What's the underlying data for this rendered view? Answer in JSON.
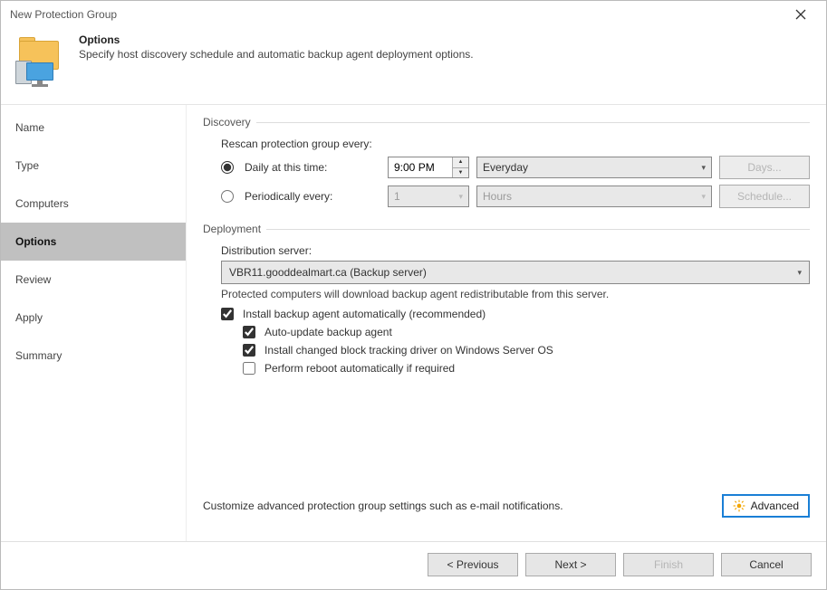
{
  "window": {
    "title": "New Protection Group"
  },
  "header": {
    "title": "Options",
    "subtitle": "Specify host discovery schedule and automatic backup agent deployment options."
  },
  "sidebar": {
    "items": [
      {
        "label": "Name"
      },
      {
        "label": "Type"
      },
      {
        "label": "Computers"
      },
      {
        "label": "Options",
        "active": true
      },
      {
        "label": "Review"
      },
      {
        "label": "Apply"
      },
      {
        "label": "Summary"
      }
    ]
  },
  "discovery": {
    "legend": "Discovery",
    "rescan_label": "Rescan protection group every:",
    "daily": {
      "label": "Daily at this time:",
      "checked": true,
      "time": "9:00 PM",
      "day_select": "Everyday",
      "days_button": "Days..."
    },
    "periodic": {
      "label": "Periodically every:",
      "checked": false,
      "value": "1",
      "unit": "Hours",
      "schedule_button": "Schedule..."
    }
  },
  "deployment": {
    "legend": "Deployment",
    "dist_label": "Distribution server:",
    "dist_value": "VBR11.gooddealmart.ca (Backup server)",
    "hint": "Protected computers will download backup agent redistributable from this server.",
    "install_agent": {
      "label": "Install backup agent automatically (recommended)",
      "checked": true
    },
    "auto_update": {
      "label": "Auto-update backup agent",
      "checked": true
    },
    "install_cbt": {
      "label": "Install changed block tracking driver on Windows Server OS",
      "checked": true
    },
    "reboot": {
      "label": "Perform reboot automatically if required",
      "checked": false
    }
  },
  "advanced": {
    "hint": "Customize advanced protection group settings such as e-mail notifications.",
    "button": "Advanced"
  },
  "footer": {
    "previous": "< Previous",
    "next": "Next >",
    "finish": "Finish",
    "cancel": "Cancel"
  }
}
